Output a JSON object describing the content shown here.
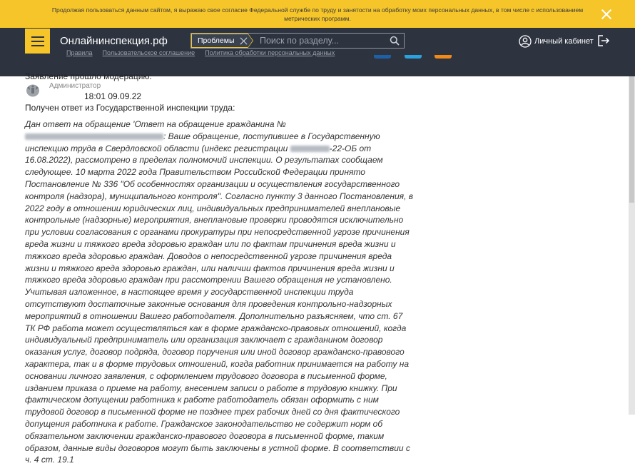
{
  "cookie": {
    "text": "Продолжая пользоваться данным сайтом, я выражаю свое согласие Федеральной службе по труду и занятости на обработку моих персональных данных, в том числе с использованием метрических программ."
  },
  "header": {
    "logo": "Онлайнинспекция.рф",
    "search_chip": "Проблемы",
    "search_placeholder": "Поиск по разделу...",
    "cabinet": "Личный кабинет"
  },
  "footer_links": [
    {
      "label": "Правила"
    },
    {
      "label": "Пользовательское соглашение"
    },
    {
      "label": "Политика обработки персональных данных"
    }
  ],
  "social_colors": [
    "#1e5fa6",
    "#2aa2de",
    "#f08b1a"
  ],
  "message": {
    "overlap_text": "Заявление прошло модерацию.",
    "role": "Администратор",
    "time": "18:01 09.09.22",
    "intro": "Получен ответ из Государственной инспекции труда:",
    "answer_a": "Дан ответ на обращение 'Ответ на обращение гражданина №",
    "answer_b": ": Ваше обращение, поступившее в Государственную инспекцию труда в Свердловской области (индекс регистрации ",
    "answer_c": "-22-ОБ от 16.08.2022), рассмотрено в пределах полномочий инспекции. О результатах сообщаем следующее. 10 марта 2022 года Правительством Российской Федерации принято Постановление № 336 \"Об особенностях организации и осуществления государственного контроля (надзора), муниципального контроля\". Согласно пункту 3 данного Постановления, в 2022 году в отношении юридических лиц, индивидуальных предпринимателей внеплановые контрольные (надзорные) мероприятия, внеплановые проверки проводятся исключительно при условии согласования с органами прокуратуры при непосредственной угрозе причинения вреда жизни и тяжкого вреда здоровью граждан или по фактам причинения вреда жизни и тяжкого вреда здоровью граждан. Доводов о непосредственной угрозе причинения вреда жизни и тяжкого вреда здоровью граждан, или наличии фактов причинения вреда жизни и тяжкого вреда здоровью граждан при рассмотрении Вашего обращения не установлено. Учитывая изложенное, в настоящее время у государственной инспекции труда отсутствуют достаточные законные основания для проведения контрольно-надзорных мероприятий в отношении Вашего работодателя. Дополнительно разъясняем, что ст. 67 ТК РФ работа может осуществляться как в форме гражданско-правовых отношений, когда индивидуальный предприниматель или организация заключает с гражданином договор оказания услуг, договор подряда, договор поручения или иной договор гражданско-правового характера, так и в форме трудовых отношений, когда работник принимается на работу на основании личного заявления, с оформлением трудового договора в письменной форме, изданием приказа о приеме на работу, внесением записи о работе в трудовую книжку. При фактическом допущении работника к работе работодатель обязан оформить с ним трудовой договор в письменной форме не позднее трех рабочих дней со дня фактического допущения работника к работе. Гражданское законодательство не содержит норм об обязательном заключении гражданско-правового договора в письменной форме, таким образом, данные виды договоров могут быть заключены в устной форме. В соответствии с ч. 4 ст. 19.1"
  }
}
